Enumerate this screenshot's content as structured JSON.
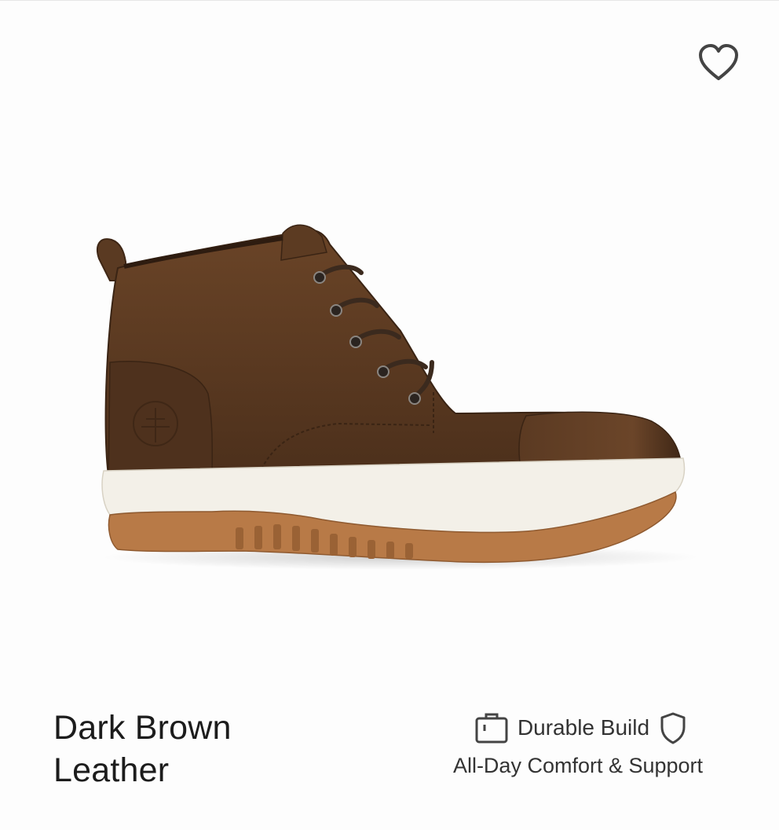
{
  "product": {
    "name": "Dark Brown Leather",
    "name_line1": "Dark Brown",
    "name_line2": "Leather",
    "image_icon": "chukka-boot-image"
  },
  "actions": {
    "favorite_icon": "heart-outline-icon"
  },
  "features": {
    "durable_label": "Durable Build",
    "durable_icon": "briefcase-icon",
    "shield_icon": "shield-icon",
    "comfort_label": "All-Day Comfort & Support"
  },
  "colors": {
    "leather": "#5a3a22",
    "leather_dark": "#3f2716",
    "midsole": "#f3f0e8",
    "outsole": "#b87a47",
    "icon": "#444444"
  }
}
